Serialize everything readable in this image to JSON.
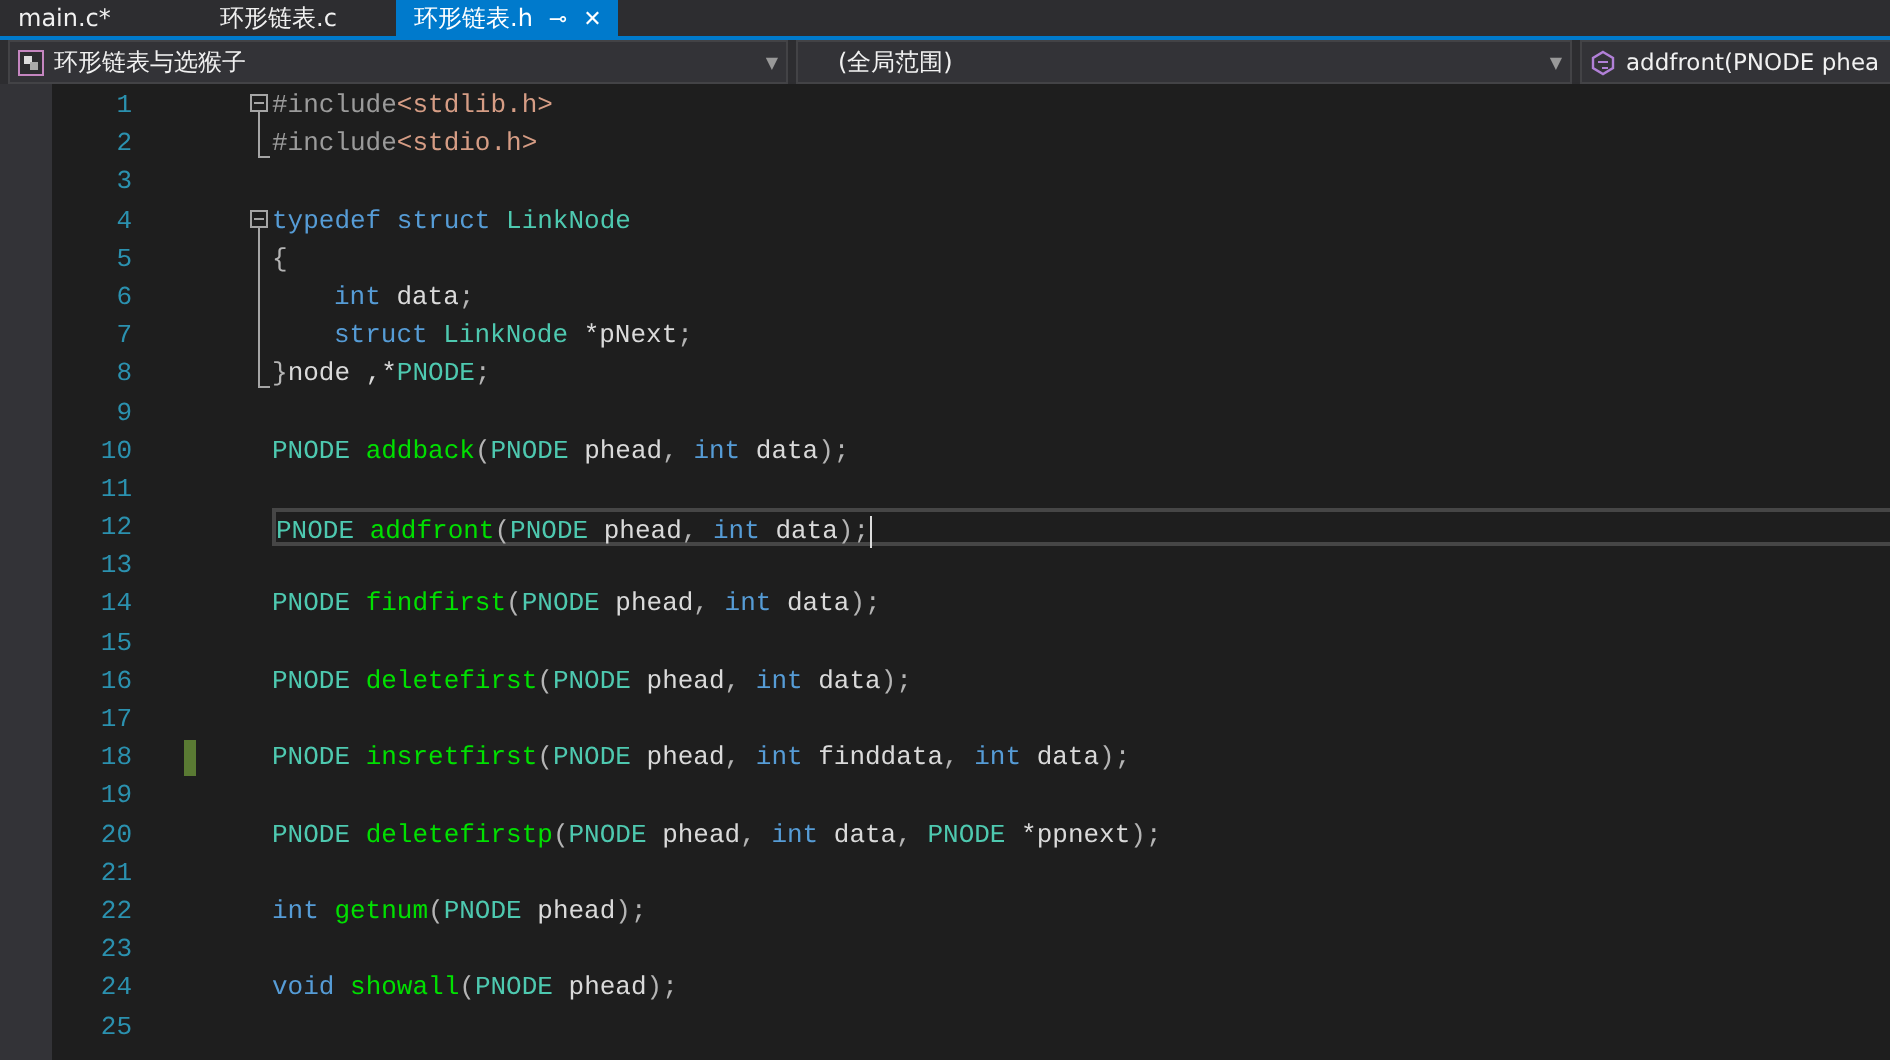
{
  "tabs": [
    {
      "label": "main.c*",
      "selected": false
    },
    {
      "label": "环形链表.c",
      "selected": false
    },
    {
      "label": "环形链表.h",
      "selected": true,
      "pin": "⊸",
      "close": "✕"
    }
  ],
  "navbar": {
    "project": {
      "text": "环形链表与选猴子",
      "caret": "▼"
    },
    "scope": {
      "text": "(全局范围)",
      "caret": "▼"
    },
    "member": {
      "text": "addfront(PNODE phea"
    }
  },
  "editor": {
    "lines": [
      {
        "number": "1",
        "kind": "fold_start",
        "tokens": [
          {
            "kind": "preproc",
            "text": "#include"
          },
          {
            "kind": "string",
            "text": "<stdlib.h>"
          }
        ]
      },
      {
        "number": "2",
        "kind": "fold_end",
        "tokens": [
          {
            "kind": "preproc",
            "text": "#include"
          },
          {
            "kind": "string",
            "text": "<stdio.h>"
          }
        ]
      },
      {
        "number": "3"
      },
      {
        "number": "4",
        "kind": "fold_start",
        "tokens": [
          {
            "kind": "keyword",
            "text": "typedef"
          },
          {
            "kind": "keyword",
            "text": " struct"
          },
          {
            "kind": "type",
            "text": " LinkNode"
          }
        ]
      },
      {
        "number": "5",
        "kind": "fold_inner",
        "tokens": [
          {
            "kind": "punct",
            "text": "{"
          }
        ]
      },
      {
        "number": "6",
        "kind": "fold_inner",
        "indented": true,
        "tokens": [
          {
            "kind": "keyword",
            "text": "int"
          },
          {
            "kind": "ident",
            "text": " data"
          },
          {
            "kind": "punct",
            "text": ";"
          }
        ]
      },
      {
        "number": "7",
        "kind": "fold_inner",
        "indented": true,
        "tokens": [
          {
            "kind": "keyword",
            "text": "struct"
          },
          {
            "kind": "type",
            "text": " LinkNode"
          },
          {
            "kind": "ident",
            "text": " *pNext"
          },
          {
            "kind": "punct",
            "text": ";"
          }
        ]
      },
      {
        "number": "8",
        "kind": "fold_end",
        "tokens": [
          {
            "kind": "punct",
            "text": "}"
          },
          {
            "kind": "ident",
            "text": "node ,*"
          },
          {
            "kind": "type",
            "text": "PNODE"
          },
          {
            "kind": "punct",
            "text": ";"
          }
        ]
      },
      {
        "number": "9"
      },
      {
        "number": "10",
        "tokens": [
          {
            "kind": "type",
            "text": "PNODE"
          },
          {
            "kind": "func",
            "text": " addback"
          },
          {
            "kind": "punct",
            "text": "("
          },
          {
            "kind": "type",
            "text": "PNODE"
          },
          {
            "kind": "ident",
            "text": " phead"
          },
          {
            "kind": "punct",
            "text": ", "
          },
          {
            "kind": "keyword",
            "text": "int"
          },
          {
            "kind": "ident",
            "text": " data"
          },
          {
            "kind": "punct",
            "text": ");"
          }
        ]
      },
      {
        "number": "11"
      },
      {
        "number": "12",
        "current": true,
        "tokens": [
          {
            "kind": "type",
            "text": "PNODE"
          },
          {
            "kind": "func",
            "text": " addfront"
          },
          {
            "kind": "punct",
            "text": "("
          },
          {
            "kind": "type",
            "text": "PNODE"
          },
          {
            "kind": "ident",
            "text": " phead"
          },
          {
            "kind": "punct",
            "text": ", "
          },
          {
            "kind": "keyword",
            "text": "int"
          },
          {
            "kind": "ident",
            "text": " data"
          },
          {
            "kind": "punct",
            "text": ");"
          }
        ]
      },
      {
        "number": "13"
      },
      {
        "number": "14",
        "tokens": [
          {
            "kind": "type",
            "text": "PNODE"
          },
          {
            "kind": "func",
            "text": " findfirst"
          },
          {
            "kind": "punct",
            "text": "("
          },
          {
            "kind": "type",
            "text": "PNODE"
          },
          {
            "kind": "ident",
            "text": " phead"
          },
          {
            "kind": "punct",
            "text": ", "
          },
          {
            "kind": "keyword",
            "text": "int"
          },
          {
            "kind": "ident",
            "text": " data"
          },
          {
            "kind": "punct",
            "text": ");"
          }
        ]
      },
      {
        "number": "15"
      },
      {
        "number": "16",
        "tokens": [
          {
            "kind": "type",
            "text": "PNODE"
          },
          {
            "kind": "func",
            "text": " deletefirst"
          },
          {
            "kind": "punct",
            "text": "("
          },
          {
            "kind": "type",
            "text": "PNODE"
          },
          {
            "kind": "ident",
            "text": " phead"
          },
          {
            "kind": "punct",
            "text": ", "
          },
          {
            "kind": "keyword",
            "text": "int"
          },
          {
            "kind": "ident",
            "text": " data"
          },
          {
            "kind": "punct",
            "text": ");"
          }
        ]
      },
      {
        "number": "17"
      },
      {
        "number": "18",
        "modified": true,
        "tokens": [
          {
            "kind": "type",
            "text": "PNODE"
          },
          {
            "kind": "func",
            "text": " insretfirst"
          },
          {
            "kind": "punct",
            "text": "("
          },
          {
            "kind": "type",
            "text": "PNODE"
          },
          {
            "kind": "ident",
            "text": " phead"
          },
          {
            "kind": "punct",
            "text": ", "
          },
          {
            "kind": "keyword",
            "text": "int"
          },
          {
            "kind": "ident",
            "text": " finddata"
          },
          {
            "kind": "punct",
            "text": ", "
          },
          {
            "kind": "keyword",
            "text": "int"
          },
          {
            "kind": "ident",
            "text": " data"
          },
          {
            "kind": "punct",
            "text": ");"
          }
        ]
      },
      {
        "number": "19"
      },
      {
        "number": "20",
        "tokens": [
          {
            "kind": "type",
            "text": "PNODE"
          },
          {
            "kind": "func",
            "text": " deletefirstp"
          },
          {
            "kind": "punct",
            "text": "("
          },
          {
            "kind": "type",
            "text": "PNODE"
          },
          {
            "kind": "ident",
            "text": " phead"
          },
          {
            "kind": "punct",
            "text": ", "
          },
          {
            "kind": "keyword",
            "text": "int"
          },
          {
            "kind": "ident",
            "text": " data"
          },
          {
            "kind": "punct",
            "text": ", "
          },
          {
            "kind": "type",
            "text": "PNODE"
          },
          {
            "kind": "ident",
            "text": " *ppnext"
          },
          {
            "kind": "punct",
            "text": ");"
          }
        ]
      },
      {
        "number": "21"
      },
      {
        "number": "22",
        "tokens": [
          {
            "kind": "keyword",
            "text": "int"
          },
          {
            "kind": "func",
            "text": " getnum"
          },
          {
            "kind": "punct",
            "text": "("
          },
          {
            "kind": "type",
            "text": "PNODE"
          },
          {
            "kind": "ident",
            "text": " phead"
          },
          {
            "kind": "punct",
            "text": ");"
          }
        ]
      },
      {
        "number": "23"
      },
      {
        "number": "24",
        "tokens": [
          {
            "kind": "keyword",
            "text": "void"
          },
          {
            "kind": "func",
            "text": " showall"
          },
          {
            "kind": "punct",
            "text": "("
          },
          {
            "kind": "type",
            "text": "PNODE"
          },
          {
            "kind": "ident",
            "text": " phead"
          },
          {
            "kind": "punct",
            "text": ");"
          }
        ]
      },
      {
        "number": "25"
      }
    ]
  }
}
